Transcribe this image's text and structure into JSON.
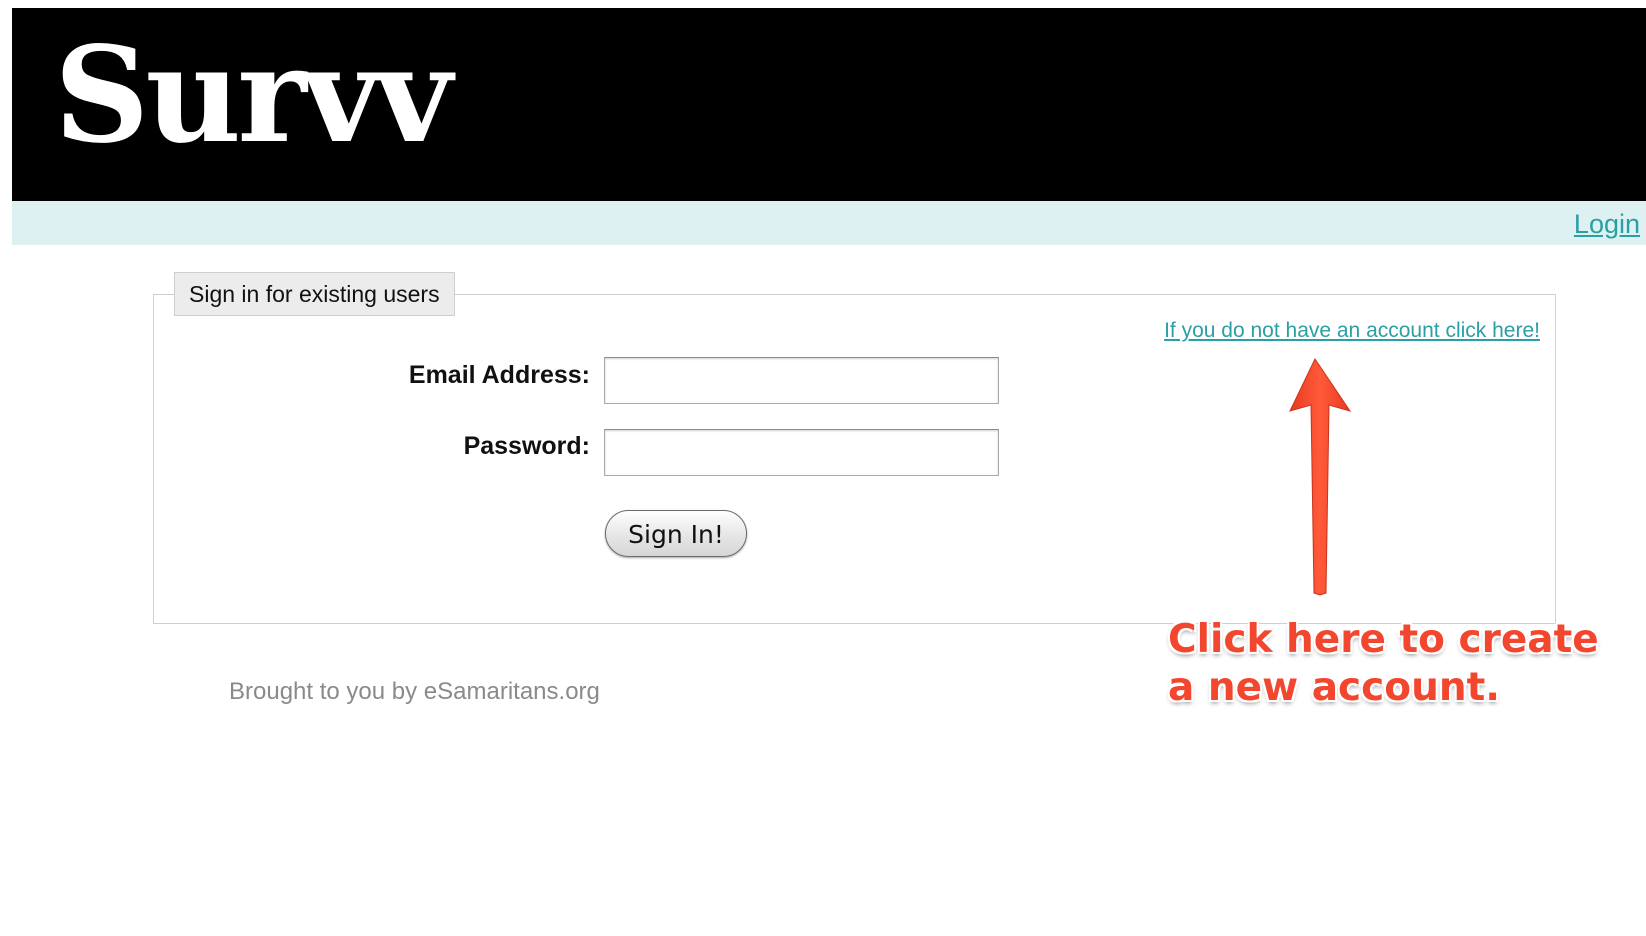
{
  "header": {
    "logo_text": "Survv",
    "background_color": "#000000"
  },
  "navbar": {
    "login_link": "Login",
    "background_color": "#ddf1f2",
    "link_color": "#2aa0a4"
  },
  "signin_panel": {
    "legend": "Sign in for existing users",
    "signup_link": "If you do not have an account click here!",
    "email_label": "Email Address:",
    "email_value": "",
    "password_label": "Password:",
    "password_value": "",
    "submit_label": "Sign In!"
  },
  "footer": {
    "credit": "Brought to you by eSamaritans.org"
  },
  "annotation": {
    "text": "Click here to create a new account.",
    "color": "#f2472e",
    "arrow_icon": "up-arrow-icon"
  }
}
